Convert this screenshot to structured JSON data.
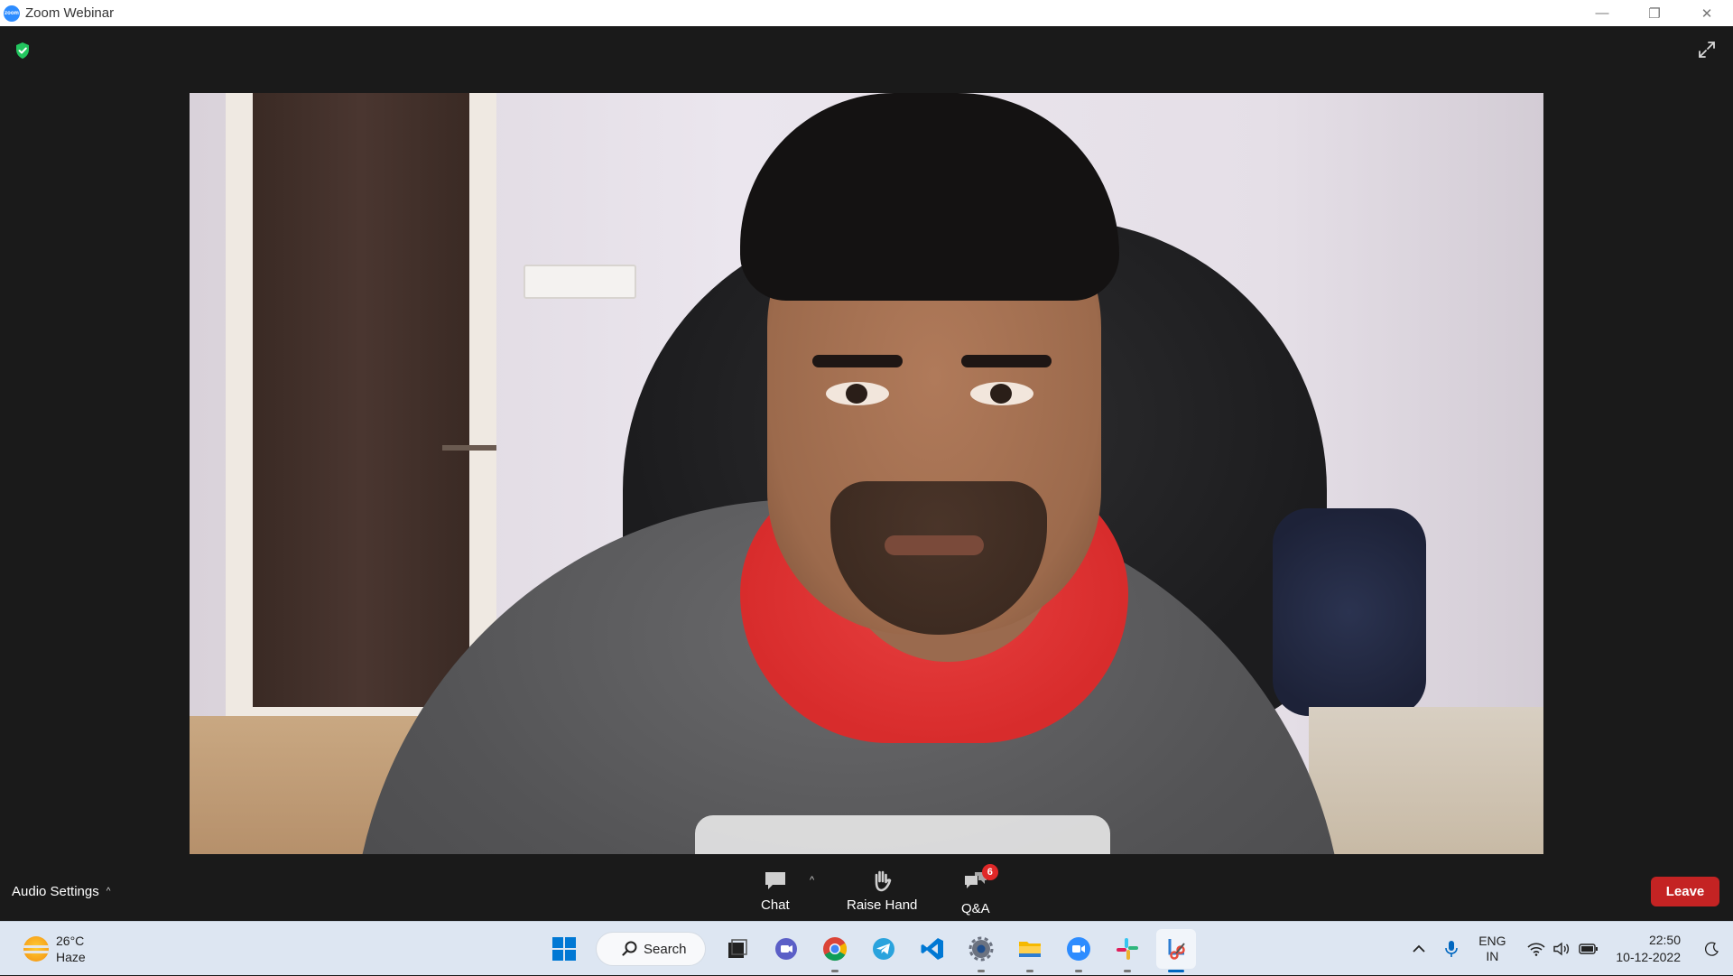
{
  "window": {
    "title": "Zoom Webinar",
    "app_icon_label": "zoom",
    "minimize_glyph": "—",
    "restore_glyph": "❐",
    "close_glyph": "✕"
  },
  "meeting": {
    "security_icon": "shield-check-icon",
    "fullscreen_icon": "expand-icon"
  },
  "controls": {
    "audio_settings_label": "Audio Settings",
    "chat_label": "Chat",
    "raise_hand_label": "Raise Hand",
    "qa_label": "Q&A",
    "qa_badge_count": "6",
    "leave_label": "Leave"
  },
  "taskbar": {
    "weather": {
      "temp": "26°C",
      "condition": "Haze"
    },
    "search_label": "Search",
    "apps": [
      "start-icon",
      "task-view-icon",
      "teams-chat-icon",
      "chrome-icon",
      "telegram-icon",
      "vscode-icon",
      "settings-icon",
      "file-explorer-icon",
      "zoom-icon",
      "slack-icon",
      "snipping-tool-icon"
    ],
    "tray": {
      "lang_line1": "ENG",
      "lang_line2": "IN",
      "time": "22:50",
      "date": "10-12-2022"
    }
  },
  "colors": {
    "meeting_bg": "#1a1a1a",
    "leave_red": "#c42323",
    "badge_red": "#e02828",
    "shield_green": "#22c55e",
    "taskbar_bg": "#dde6f2"
  }
}
